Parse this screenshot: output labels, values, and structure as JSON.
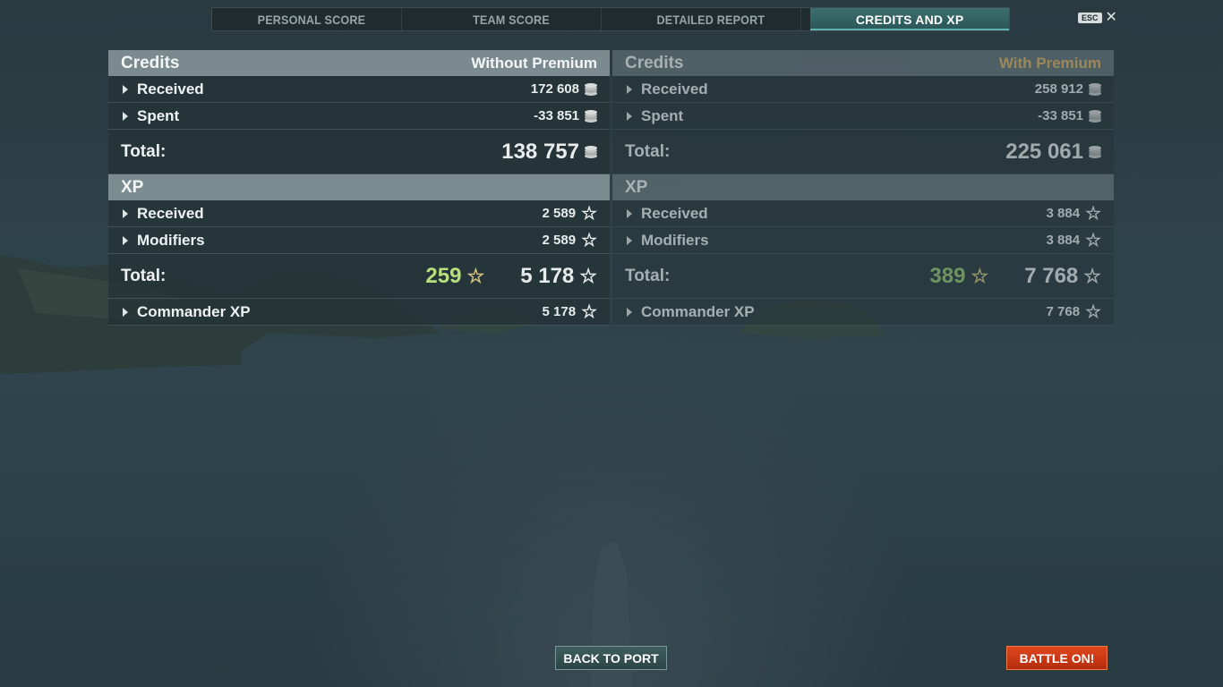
{
  "tabs": [
    {
      "label": "PERSONAL SCORE",
      "active": false
    },
    {
      "label": "TEAM SCORE",
      "active": false
    },
    {
      "label": "DETAILED REPORT",
      "active": false
    },
    {
      "label": "CREDITS AND XP",
      "active": true
    }
  ],
  "esc": {
    "key": "ESC",
    "close": "✕"
  },
  "without_premium": {
    "credits_title": "Credits",
    "column_title": "Without Premium",
    "received_label": "Received",
    "received_value": "172 608",
    "spent_label": "Spent",
    "spent_value": "-33 851",
    "total_label": "Total:",
    "credits_total": "138 757",
    "xp_title": "XP",
    "xp_received_label": "Received",
    "xp_received_value": "2 589",
    "modifiers_label": "Modifiers",
    "modifiers_value": "2 589",
    "xp_total_label": "Total:",
    "free_xp": "259",
    "xp_total": "5 178",
    "commander_label": "Commander XP",
    "commander_value": "5 178"
  },
  "with_premium": {
    "credits_title": "Credits",
    "column_title": "With Premium",
    "received_label": "Received",
    "received_value": "258 912",
    "spent_label": "Spent",
    "spent_value": "-33 851",
    "total_label": "Total:",
    "credits_total": "225 061",
    "xp_title": "XP",
    "xp_received_label": "Received",
    "xp_received_value": "3 884",
    "modifiers_label": "Modifiers",
    "modifiers_value": "3 884",
    "xp_total_label": "Total:",
    "free_xp": "389",
    "xp_total": "7 768",
    "commander_label": "Commander XP",
    "commander_value": "7 768"
  },
  "buttons": {
    "back": "BACK TO PORT",
    "battle": "BATTLE ON!"
  },
  "icons": {
    "credit": "credit-coin-icon",
    "xp": "xp-star-icon",
    "free_xp": "free-xp-star-icon",
    "expand": "expand-arrow-icon"
  },
  "colors": {
    "active_tab": "#2f6363",
    "free_xp": "#b7e07c",
    "premium_title": "#e0b86a",
    "battle_button": "#d0401a"
  }
}
